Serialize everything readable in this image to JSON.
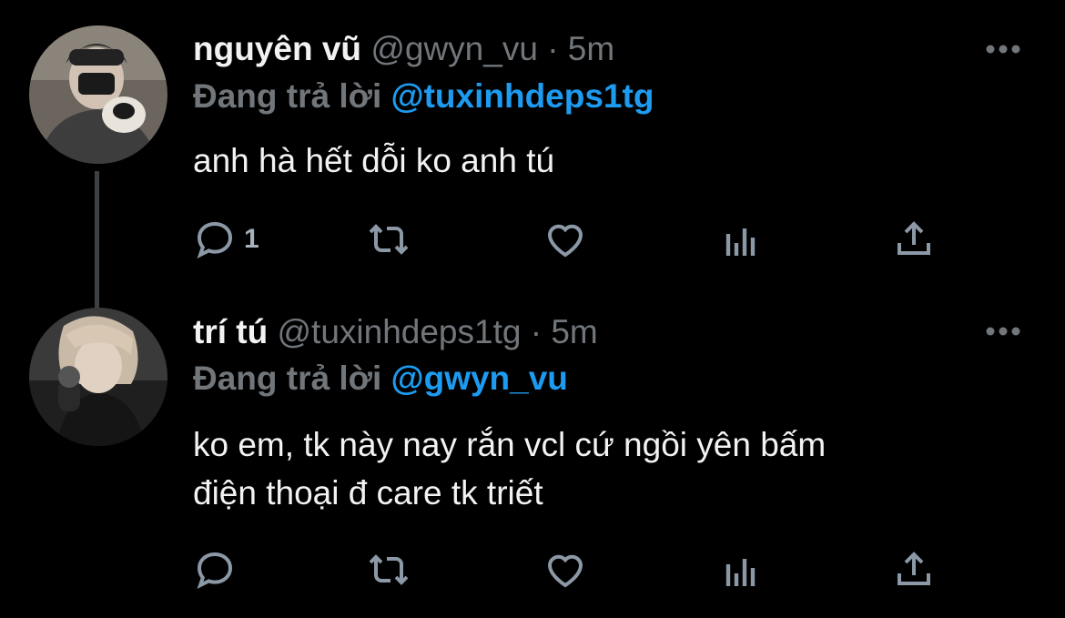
{
  "tweets": [
    {
      "display_name": "nguyên vũ",
      "handle": "@gwyn_vu",
      "separator": "·",
      "time": "5m",
      "reply_prefix": "Đang trả lời",
      "reply_to": "@tuxinhdeps1tg",
      "text_lines": [
        "anh hà hết dỗi ko anh tú"
      ],
      "reply_count": "1",
      "icons": [
        "avatar",
        "more-icon",
        "reply-icon",
        "retweet-icon",
        "like-icon",
        "analytics-icon",
        "share-icon"
      ]
    },
    {
      "display_name": "trí tú",
      "handle": "@tuxinhdeps1tg",
      "separator": "·",
      "time": "5m",
      "reply_prefix": "Đang trả lời",
      "reply_to": "@gwyn_vu",
      "text_lines": [
        "ko em, tk này nay rắn vcl cứ ngồi yên bấm",
        "điện thoại đ care tk triết"
      ],
      "reply_count": "",
      "icons": [
        "avatar",
        "more-icon",
        "reply-icon",
        "retweet-icon",
        "like-icon",
        "analytics-icon",
        "share-icon"
      ]
    }
  ],
  "colors": {
    "background": "#000000",
    "text": "#e7e9ea",
    "secondary_text": "#71767b",
    "accent": "#1d9bf0",
    "icon": "#8b98a5",
    "thread_line": "#3e4144"
  }
}
